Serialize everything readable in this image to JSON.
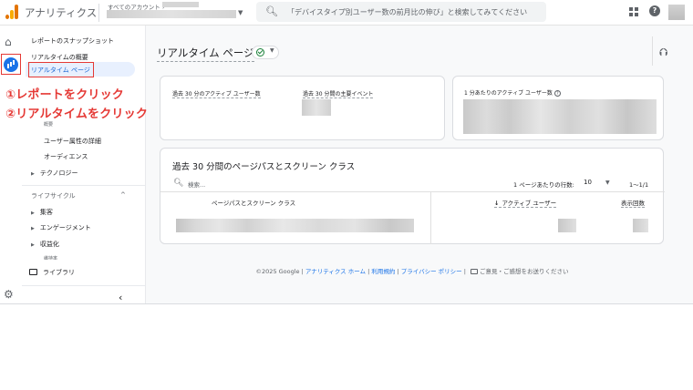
{
  "header": {
    "app_title": "アナリティクス",
    "account_label": "すべてのアカウント",
    "search_placeholder": "「デバイスタイプ別ユーザー数の前月比の伸び」と検索してみてください"
  },
  "sidebar": {
    "snapshot": "レポートのスナップショット",
    "realtime_overview": "リアルタイムの概要",
    "realtime_page": "リアルタイム ページ",
    "hidden_item": "概要",
    "user_attr_detail": "ユーザー属性の詳細",
    "audience": "オーディエンス",
    "technology": "テクノロジー",
    "lifecycle": "ライフサイクル",
    "acquisition": "集客",
    "engagement": "エンゲージメント",
    "monetization": "収益化",
    "retention": "維持率",
    "library": "ライブラリ"
  },
  "annotations": {
    "step1": "①レポートをクリック",
    "step2": "②リアルタイムをクリック"
  },
  "main": {
    "page_title": "リアルタイム ページ",
    "metrics": {
      "active_users_30": "過去 30 分のアクティブ ユーザー数",
      "key_events_30": "過去 30 分間の主要イベント",
      "active_users_per_min": "1 分あたりのアクティブ ユーザー数"
    },
    "table": {
      "title": "過去 30 分間のページパスとスクリーン クラス",
      "search_placeholder": "検索...",
      "rows_per_page_label": "1 ページあたりの行数:",
      "rows_per_page_value": "10",
      "pager": "1～1/1",
      "col_path": "ページパスとスクリーン クラス",
      "col_users": "アクティブ ユーザー",
      "col_views": "表示回数"
    }
  },
  "footer": {
    "copyright": "©2025 Google",
    "home": "アナリティクス ホーム",
    "terms": "利用規約",
    "privacy": "プライバシー ポリシー",
    "feedback": "ご意見・ご感想をお送りください"
  },
  "colors": {
    "accent": "#1a73e8",
    "annotation": "#e53935",
    "ok": "#188038"
  }
}
